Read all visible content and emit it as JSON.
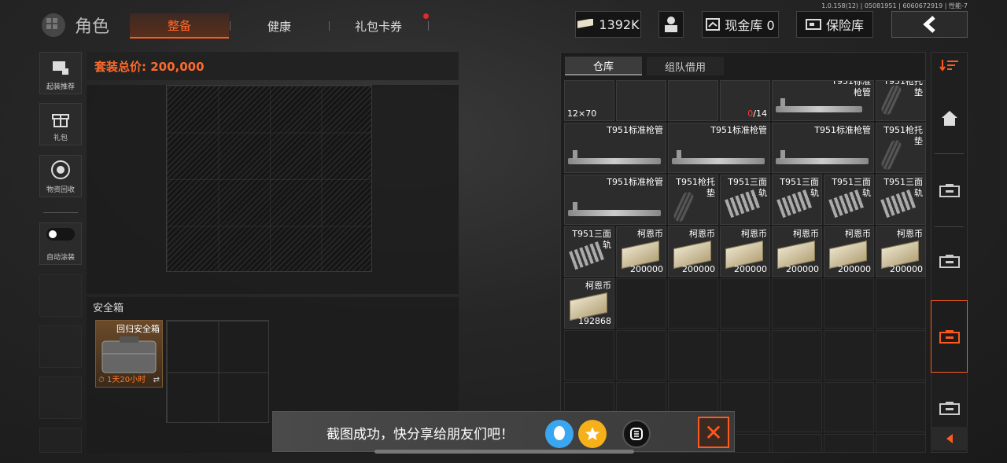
{
  "version": "1.0.158(12) | 05081951 | 6060672919 | 性能-7",
  "header": {
    "title": "角色",
    "tabs": [
      {
        "label": "整备",
        "active": true
      },
      {
        "label": "健康",
        "active": false
      },
      {
        "label": "礼包卡券",
        "active": false,
        "badge": true
      }
    ],
    "currency": "1392K",
    "cash_vault": "现金库 0",
    "safe_vault": "保险库"
  },
  "sidebar": {
    "items": [
      {
        "label": "起装推荐",
        "icon": "loadout-icon"
      },
      {
        "label": "礼包",
        "icon": "gift-icon"
      },
      {
        "label": "物资回收",
        "icon": "recycle-icon"
      },
      {
        "label": "自动涂装",
        "icon": "toggle-icon"
      }
    ]
  },
  "loadout": {
    "total_price": "套装总价: 200,000",
    "safe_label": "安全箱",
    "safe_item": {
      "name": "回归安全箱",
      "time": "1天20小时"
    }
  },
  "warehouse": {
    "tabs": [
      {
        "label": "仓库",
        "active": true
      },
      {
        "label": "组队借用",
        "active": false
      }
    ],
    "partial_row": {
      "size": "12×70",
      "count_red": "0",
      "count_rest": "/14",
      "name1": "T951标准枪管",
      "name2": "T951枪托垫"
    },
    "items": [
      {
        "name": "T951标准枪管",
        "type": "gun"
      },
      {
        "name": "T951标准枪管",
        "type": "gun"
      },
      {
        "name": "T951标准枪管",
        "type": "gun"
      },
      {
        "name": "T951枪托垫",
        "type": "stock"
      },
      {
        "name": "T951标准枪管",
        "type": "gun"
      },
      {
        "name": "T951枪托垫",
        "type": "stock"
      },
      {
        "name": "T951三面轨",
        "type": "rail"
      },
      {
        "name": "T951三面轨",
        "type": "rail"
      },
      {
        "name": "T951三面轨",
        "type": "rail"
      },
      {
        "name": "T951三面轨",
        "type": "rail"
      },
      {
        "name": "T951三面轨",
        "type": "rail"
      },
      {
        "name": "柯恩币",
        "type": "cash",
        "count": "200000"
      },
      {
        "name": "柯恩币",
        "type": "cash",
        "count": "200000"
      },
      {
        "name": "柯恩币",
        "type": "cash",
        "count": "200000"
      },
      {
        "name": "柯恩币",
        "type": "cash",
        "count": "200000"
      },
      {
        "name": "柯恩币",
        "type": "cash",
        "count": "200000"
      },
      {
        "name": "柯恩币",
        "type": "cash",
        "count": "200000"
      },
      {
        "name": "柯恩币",
        "type": "cash",
        "count": "192868"
      }
    ]
  },
  "toast": {
    "message": "截图成功，快分享给朋友们吧！",
    "close": "✕"
  }
}
